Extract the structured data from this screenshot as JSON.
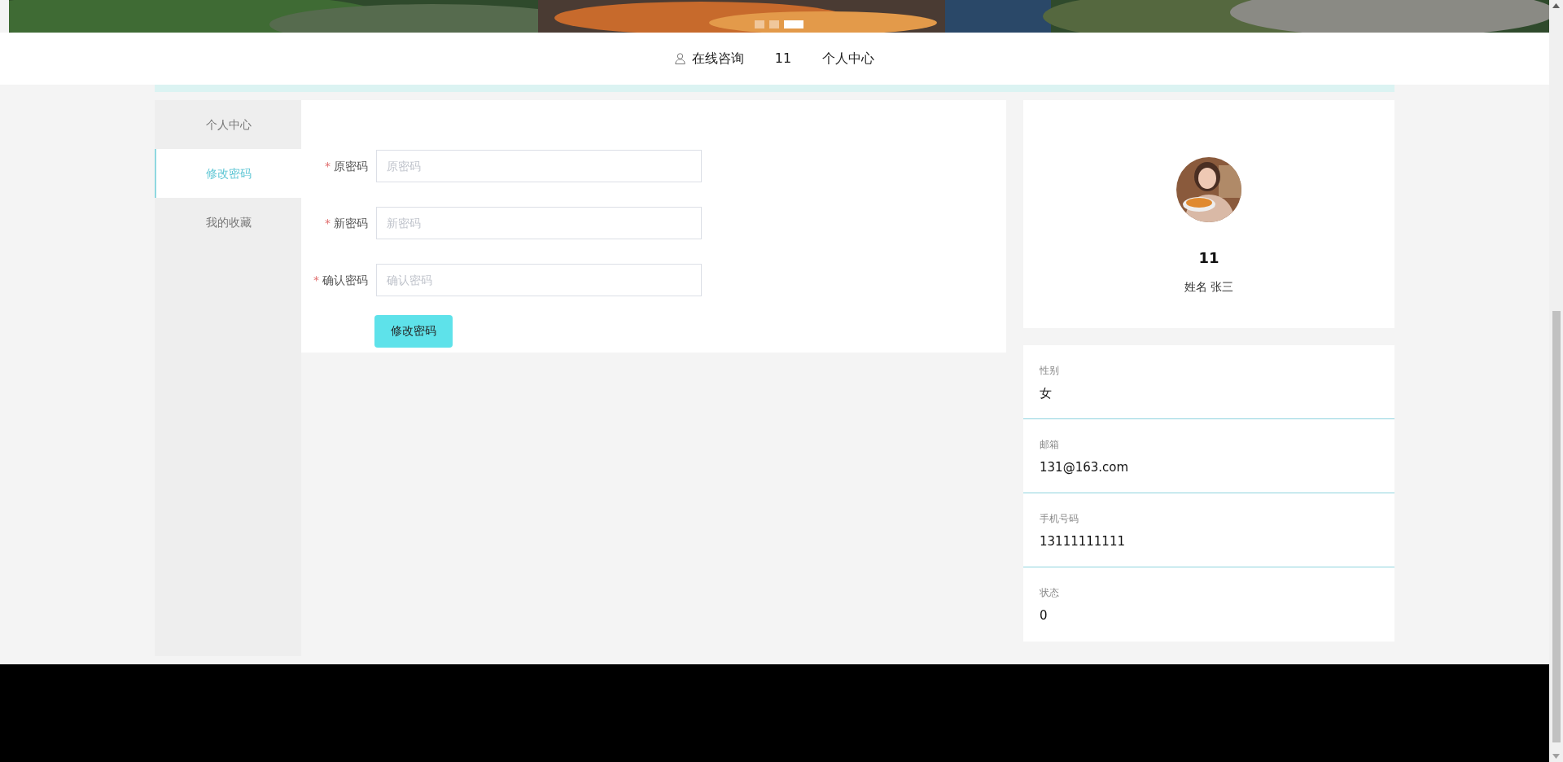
{
  "banner": {
    "kind": "picture",
    "dots": [
      {
        "selected": false
      },
      {
        "selected": false
      },
      {
        "selected": true
      }
    ]
  },
  "nav": {
    "items": [
      {
        "label": "在线咨询",
        "kind": "user-link"
      },
      {
        "label": "11",
        "kind": "link"
      },
      {
        "label": "个人中心",
        "kind": "link"
      }
    ]
  },
  "sidebar": {
    "items": [
      {
        "label": "个人中心",
        "selected": false
      },
      {
        "label": "修改密码",
        "selected": true
      },
      {
        "label": "我的收藏",
        "selected": false
      }
    ]
  },
  "form": {
    "fields": [
      {
        "mark": "*",
        "label": "原密码",
        "placeholder": "原密码"
      },
      {
        "mark": "*",
        "label": "新密码",
        "placeholder": "新密码"
      },
      {
        "mark": "*",
        "label": "确认密码",
        "placeholder": "确认密码"
      }
    ],
    "submit": "修改密码"
  },
  "profile": {
    "username": "11",
    "name_line": "姓名 张三"
  },
  "details": [
    {
      "label": "性别",
      "value": "女"
    },
    {
      "label": "邮箱",
      "value": "131@163.com"
    },
    {
      "label": "手机号码",
      "value": "13111111111"
    },
    {
      "label": "状态",
      "value": "0"
    }
  ]
}
